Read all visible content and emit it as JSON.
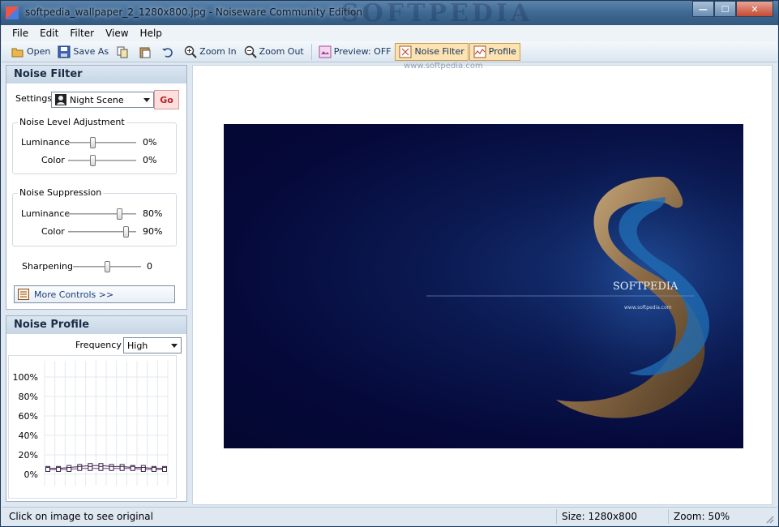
{
  "window": {
    "title": "softpedia_wallpaper_2_1280x800.jpg - Noiseware Community Edition",
    "watermark": "SOFTPEDIA"
  },
  "menu": [
    "File",
    "Edit",
    "Filter",
    "View",
    "Help"
  ],
  "toolbar": {
    "open": "Open",
    "save_as": "Save As",
    "zoom_in": "Zoom In",
    "zoom_out": "Zoom Out",
    "preview": "Preview: OFF",
    "noise_filter": "Noise Filter",
    "profile": "Profile"
  },
  "noise_filter": {
    "header": "Noise Filter",
    "settings_label": "Settings",
    "settings_value": "Night Scene",
    "go": "Go",
    "level_group": "Noise Level Adjustment",
    "level": {
      "luminance": {
        "label": "Luminance",
        "value": "0%",
        "level": 0.35
      },
      "color": {
        "label": "Color",
        "value": "0%",
        "level": 0.35
      }
    },
    "suppression_group": "Noise Suppression",
    "suppression": {
      "luminance": {
        "label": "Luminance",
        "value": "80%",
        "level": 0.78
      },
      "color": {
        "label": "Color",
        "value": "90%",
        "level": 0.88
      }
    },
    "sharpening": {
      "label": "Sharpening",
      "value": "0",
      "level": 0.5
    },
    "more_controls": "More Controls >>"
  },
  "noise_profile": {
    "header": "Noise Profile",
    "frequency_label": "Frequency",
    "frequency_value": "High"
  },
  "chart_data": {
    "type": "line",
    "yticks": [
      "100%",
      "80%",
      "60%",
      "40%",
      "20%",
      "0%"
    ],
    "ylim": [
      0,
      100
    ],
    "grid": true,
    "series": [
      {
        "values": [
          6,
          6,
          7,
          8,
          9,
          9,
          8,
          8,
          7,
          7,
          6,
          6
        ]
      },
      {
        "values": [
          5,
          5,
          5,
          6,
          6,
          6,
          6,
          6,
          6,
          5,
          5,
          5
        ]
      }
    ]
  },
  "image": {
    "watermark_text": "www.softpedia.com",
    "logo_text": "SOFTPEDIA"
  },
  "status": {
    "hint": "Click on image to see original",
    "size": "Size: 1280x800",
    "zoom": "Zoom: 50%"
  }
}
